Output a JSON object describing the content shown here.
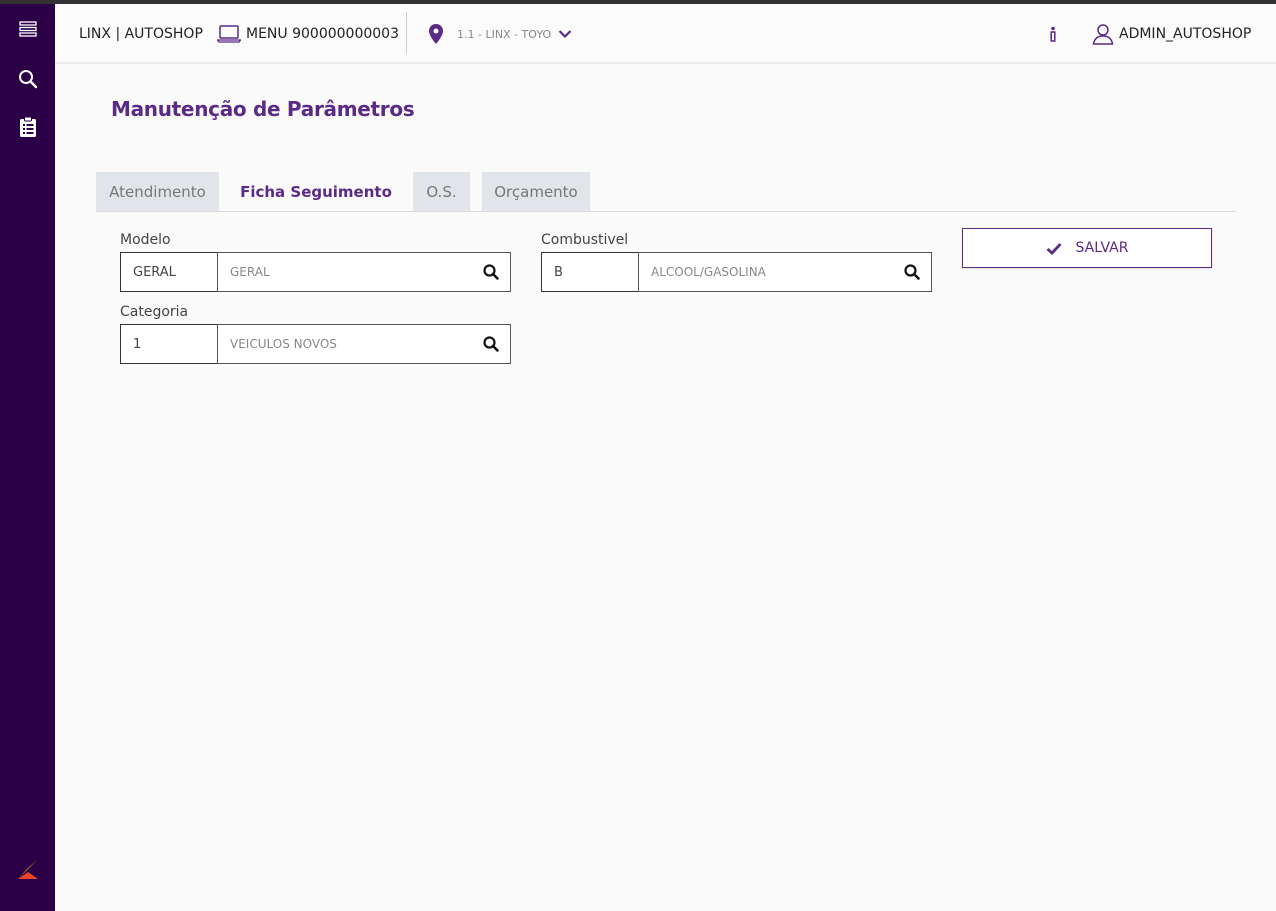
{
  "header": {
    "brand": "LINX | AUTOSHOP",
    "menu_label": "MENU 900000000003",
    "location": "1.1 - LINX - TOYO",
    "user": "ADMIN_AUTOSHOP"
  },
  "page": {
    "title": "Manutenção de Parâmetros"
  },
  "tabs": [
    {
      "label": "Atendimento"
    },
    {
      "label": "Ficha Seguimento"
    },
    {
      "label": "O.S."
    },
    {
      "label": "Orçamento"
    }
  ],
  "form": {
    "modelo": {
      "label": "Modelo",
      "code": "GERAL",
      "description": "GERAL"
    },
    "combustivel": {
      "label": "Combustivel",
      "code": "B",
      "description": "ALCOOL/GASOLINA"
    },
    "categoria": {
      "label": "Categoria",
      "code": "1",
      "description": "VEICULOS NOVOS"
    }
  },
  "actions": {
    "save_label": "SALVAR"
  },
  "colors": {
    "sidebar": "#2b0046",
    "accent": "#5b2a86",
    "tab_inactive": "#e1e4e8"
  }
}
